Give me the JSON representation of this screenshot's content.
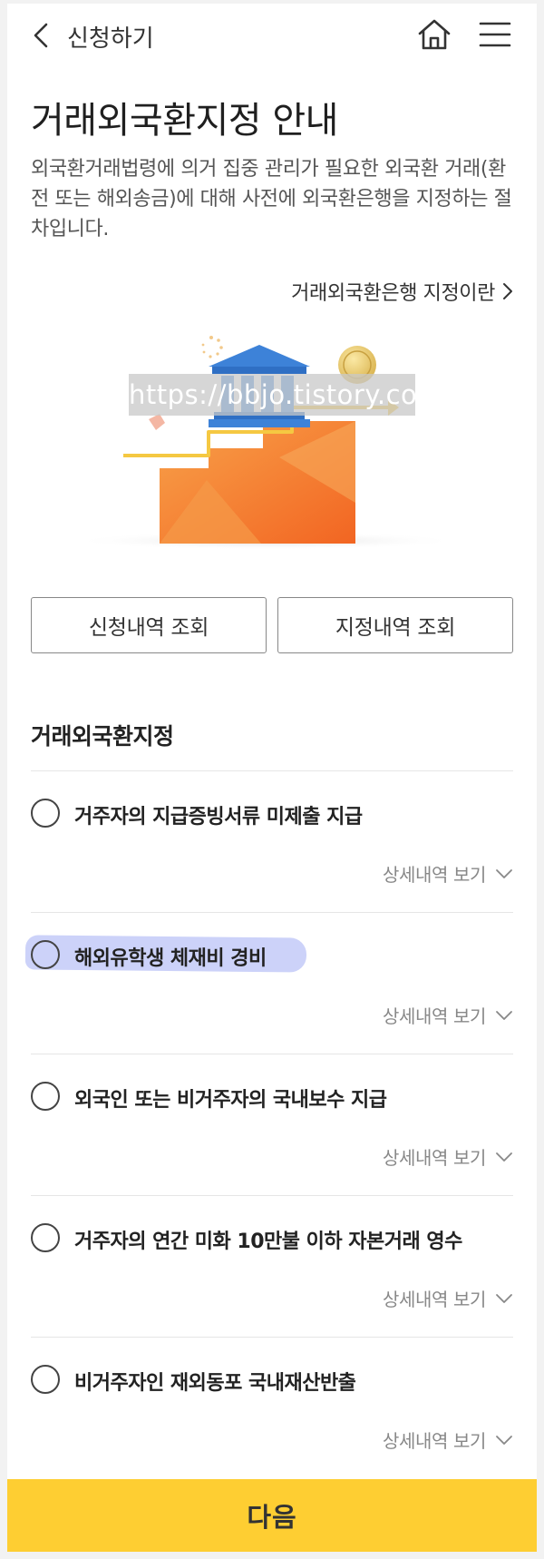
{
  "header": {
    "back_icon": "chevron-left-icon",
    "title": "신청하기",
    "home_icon": "home-icon",
    "menu_icon": "hamburger-menu-icon"
  },
  "intro": {
    "title": "거래외국환지정 안내",
    "description": "외국환거래법령에 의거 집중 관리가 필요한 외국환 거래(환전 또는 해외송금)에 대해 사전에 외국환은행을 지정하는 절차입니다.",
    "info_link": "거래외국환은행 지정이란"
  },
  "illustration": {
    "watermark": "https://bbjo.tistory.com"
  },
  "actions": {
    "history_button": "신청내역 조회",
    "designation_button": "지정내역 조회"
  },
  "section": {
    "title": "거래외국환지정"
  },
  "options": [
    {
      "label": "거주자의 지급증빙서류 미제출 지급",
      "detail": "상세내역 보기",
      "selected": false,
      "highlighted": false
    },
    {
      "label": "해외유학생 체재비 경비",
      "detail": "상세내역 보기",
      "selected": false,
      "highlighted": true
    },
    {
      "label": "외국인 또는 비거주자의 국내보수 지급",
      "detail": "상세내역 보기",
      "selected": false,
      "highlighted": false
    },
    {
      "label": "거주자의 연간 미화 10만불 이하 자본거래 영수",
      "detail": "상세내역 보기",
      "selected": false,
      "highlighted": false
    },
    {
      "label": "비거주자인 재외동포 국내재산반출",
      "detail": "상세내역 보기",
      "selected": false,
      "highlighted": false
    }
  ],
  "footer": {
    "next_button": "다음"
  },
  "colors": {
    "accent": "#fece32",
    "highlight": "#aab4f5",
    "illustration_orange": "#f57b2c",
    "bank_blue": "#3d82d8"
  }
}
